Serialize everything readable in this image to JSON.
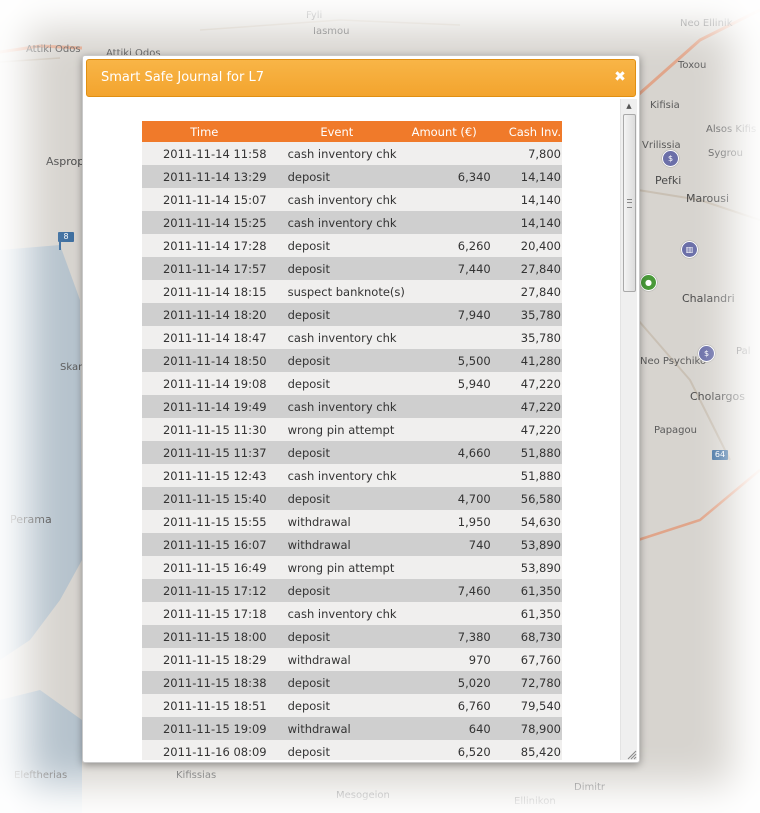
{
  "map": {
    "labels": [
      "Attiki Odos",
      "Attiki Odos",
      "Fyli",
      "Iasmou",
      "Aspropyrgos",
      "Skaramangas",
      "Perama",
      "Kifisia",
      "Neo Ellinik",
      "Toxou",
      "Alsos Kifis",
      "Sygrou",
      "Vrilissia",
      "Pefki",
      "Marousi",
      "Chalandri",
      "Neo Psychiko",
      "Cholargos",
      "Papagou",
      "Ellinikon",
      "Dimitr",
      "Pal",
      "Kifissias",
      "Mesogeion",
      "Eleftherias"
    ],
    "road_badges": [
      "8",
      "64"
    ]
  },
  "dialog": {
    "title": "Smart Safe Journal for L7",
    "close_icon": "close-icon"
  },
  "table": {
    "headers": [
      "Time",
      "Event",
      "Amount (€)",
      "Cash Inv."
    ],
    "rows": [
      {
        "time": "2011-11-14 11:58",
        "event": "cash inventory chk",
        "amount": "",
        "cash": "7,800"
      },
      {
        "time": "2011-11-14 13:29",
        "event": "deposit",
        "amount": "6,340",
        "cash": "14,140"
      },
      {
        "time": "2011-11-14 15:07",
        "event": "cash inventory chk",
        "amount": "",
        "cash": "14,140"
      },
      {
        "time": "2011-11-14 15:25",
        "event": "cash inventory chk",
        "amount": "",
        "cash": "14,140"
      },
      {
        "time": "2011-11-14 17:28",
        "event": "deposit",
        "amount": "6,260",
        "cash": "20,400"
      },
      {
        "time": "2011-11-14 17:57",
        "event": "deposit",
        "amount": "7,440",
        "cash": "27,840"
      },
      {
        "time": "2011-11-14 18:15",
        "event": "suspect banknote(s)",
        "amount": "",
        "cash": "27,840"
      },
      {
        "time": "2011-11-14 18:20",
        "event": "deposit",
        "amount": "7,940",
        "cash": "35,780"
      },
      {
        "time": "2011-11-14 18:47",
        "event": "cash inventory chk",
        "amount": "",
        "cash": "35,780"
      },
      {
        "time": "2011-11-14 18:50",
        "event": "deposit",
        "amount": "5,500",
        "cash": "41,280"
      },
      {
        "time": "2011-11-14 19:08",
        "event": "deposit",
        "amount": "5,940",
        "cash": "47,220"
      },
      {
        "time": "2011-11-14 19:49",
        "event": "cash inventory chk",
        "amount": "",
        "cash": "47,220"
      },
      {
        "time": "2011-11-15 11:30",
        "event": "wrong pin attempt",
        "amount": "",
        "cash": "47,220"
      },
      {
        "time": "2011-11-15 11:37",
        "event": "deposit",
        "amount": "4,660",
        "cash": "51,880"
      },
      {
        "time": "2011-11-15 12:43",
        "event": "cash inventory chk",
        "amount": "",
        "cash": "51,880"
      },
      {
        "time": "2011-11-15 15:40",
        "event": "deposit",
        "amount": "4,700",
        "cash": "56,580"
      },
      {
        "time": "2011-11-15 15:55",
        "event": "withdrawal",
        "amount": "1,950",
        "cash": "54,630"
      },
      {
        "time": "2011-11-15 16:07",
        "event": "withdrawal",
        "amount": "740",
        "cash": "53,890"
      },
      {
        "time": "2011-11-15 16:49",
        "event": "wrong pin attempt",
        "amount": "",
        "cash": "53,890"
      },
      {
        "time": "2011-11-15 17:12",
        "event": "deposit",
        "amount": "7,460",
        "cash": "61,350"
      },
      {
        "time": "2011-11-15 17:18",
        "event": "cash inventory chk",
        "amount": "",
        "cash": "61,350"
      },
      {
        "time": "2011-11-15 18:00",
        "event": "deposit",
        "amount": "7,380",
        "cash": "68,730"
      },
      {
        "time": "2011-11-15 18:29",
        "event": "withdrawal",
        "amount": "970",
        "cash": "67,760"
      },
      {
        "time": "2011-11-15 18:38",
        "event": "deposit",
        "amount": "5,020",
        "cash": "72,780"
      },
      {
        "time": "2011-11-15 18:51",
        "event": "deposit",
        "amount": "6,760",
        "cash": "79,540"
      },
      {
        "time": "2011-11-15 19:09",
        "event": "withdrawal",
        "amount": "640",
        "cash": "78,900"
      },
      {
        "time": "2011-11-16 08:09",
        "event": "deposit",
        "amount": "6,520",
        "cash": "85,420"
      }
    ]
  },
  "colors": {
    "title_bar": "#f5a935",
    "header_row": "#f07a2a",
    "row_light": "#f0efee",
    "row_dark": "#cfcfcf"
  }
}
